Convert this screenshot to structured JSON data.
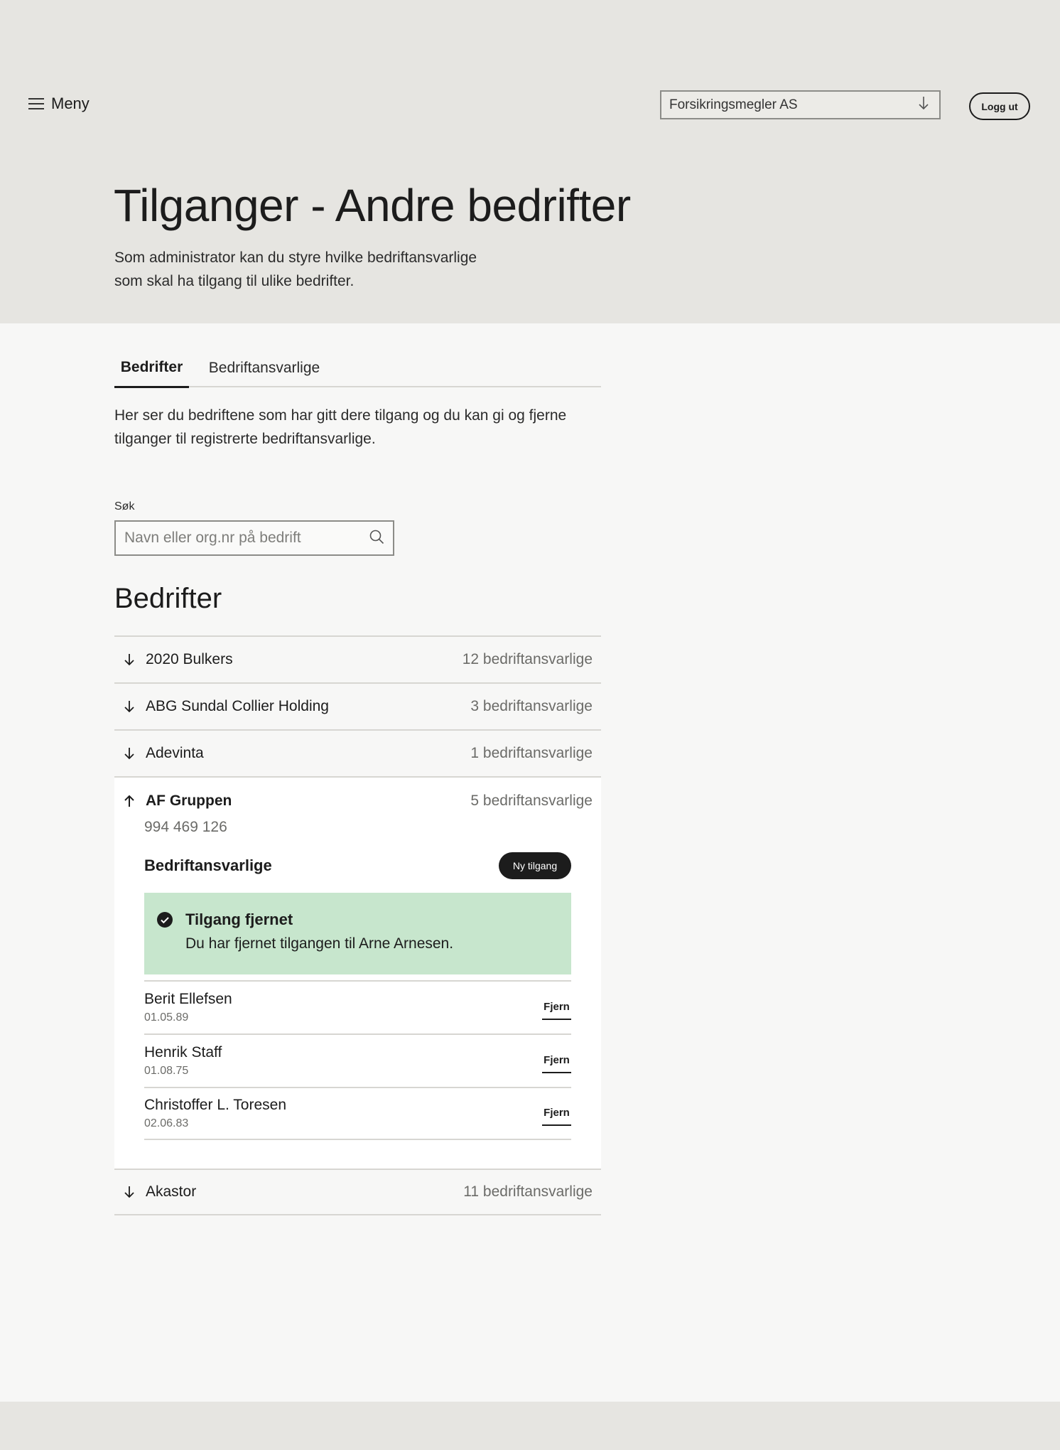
{
  "header": {
    "menu_label": "Meny",
    "org_selected": "Forsikringsmegler AS",
    "logout_label": "Logg ut"
  },
  "page": {
    "title": "Tilganger - Andre bedrifter",
    "intro_line1": "Som administrator kan du styre hvilke bedriftansvarlige",
    "intro_line2": "som skal ha tilgang til ulike bedrifter."
  },
  "tabs": [
    {
      "label": "Bedrifter",
      "active": true
    },
    {
      "label": "Bedriftansvarlige",
      "active": false
    }
  ],
  "tab_description": "Her ser du bedriftene som har gitt dere tilgang og du kan gi og fjerne tilganger til registrerte bedriftansvarlige.",
  "search": {
    "label": "Søk",
    "placeholder": "Navn eller org.nr på bedrift"
  },
  "companies_title": "Bedrifter",
  "companies": [
    {
      "name": "2020 Bulkers",
      "count": "12 bedriftansvarlige",
      "expanded": false
    },
    {
      "name": "ABG Sundal Collier Holding",
      "count": "3 bedriftansvarlige",
      "expanded": false
    },
    {
      "name": "Adevinta",
      "count": "1 bedriftansvarlige",
      "expanded": false
    },
    {
      "name": "AF Gruppen",
      "count": "5 bedriftansvarlige",
      "expanded": true
    },
    {
      "name": "Akastor",
      "count": "11 bedriftansvarlige",
      "expanded": false
    }
  ],
  "expanded_company": {
    "org_number": "994 469 126",
    "responsibles_label": "Bedriftansvarlige",
    "new_access_label": "Ny tilgang",
    "alert": {
      "title": "Tilgang fjernet",
      "text": "Du har fjernet tilgangen til Arne Arnesen."
    },
    "people": [
      {
        "name": "Berit Ellefsen",
        "date": "01.05.89",
        "action": "Fjern"
      },
      {
        "name": "Henrik Staff",
        "date": "01.08.75",
        "action": "Fjern"
      },
      {
        "name": "Christoffer L. Toresen",
        "date": "02.06.83",
        "action": "Fjern"
      }
    ]
  },
  "icons": {
    "menu": "hamburger-icon",
    "select": "arrow-down-icon",
    "search": "search-icon",
    "collapsed": "arrow-down-icon",
    "expanded": "arrow-up-icon",
    "alert": "check-circle-icon"
  }
}
